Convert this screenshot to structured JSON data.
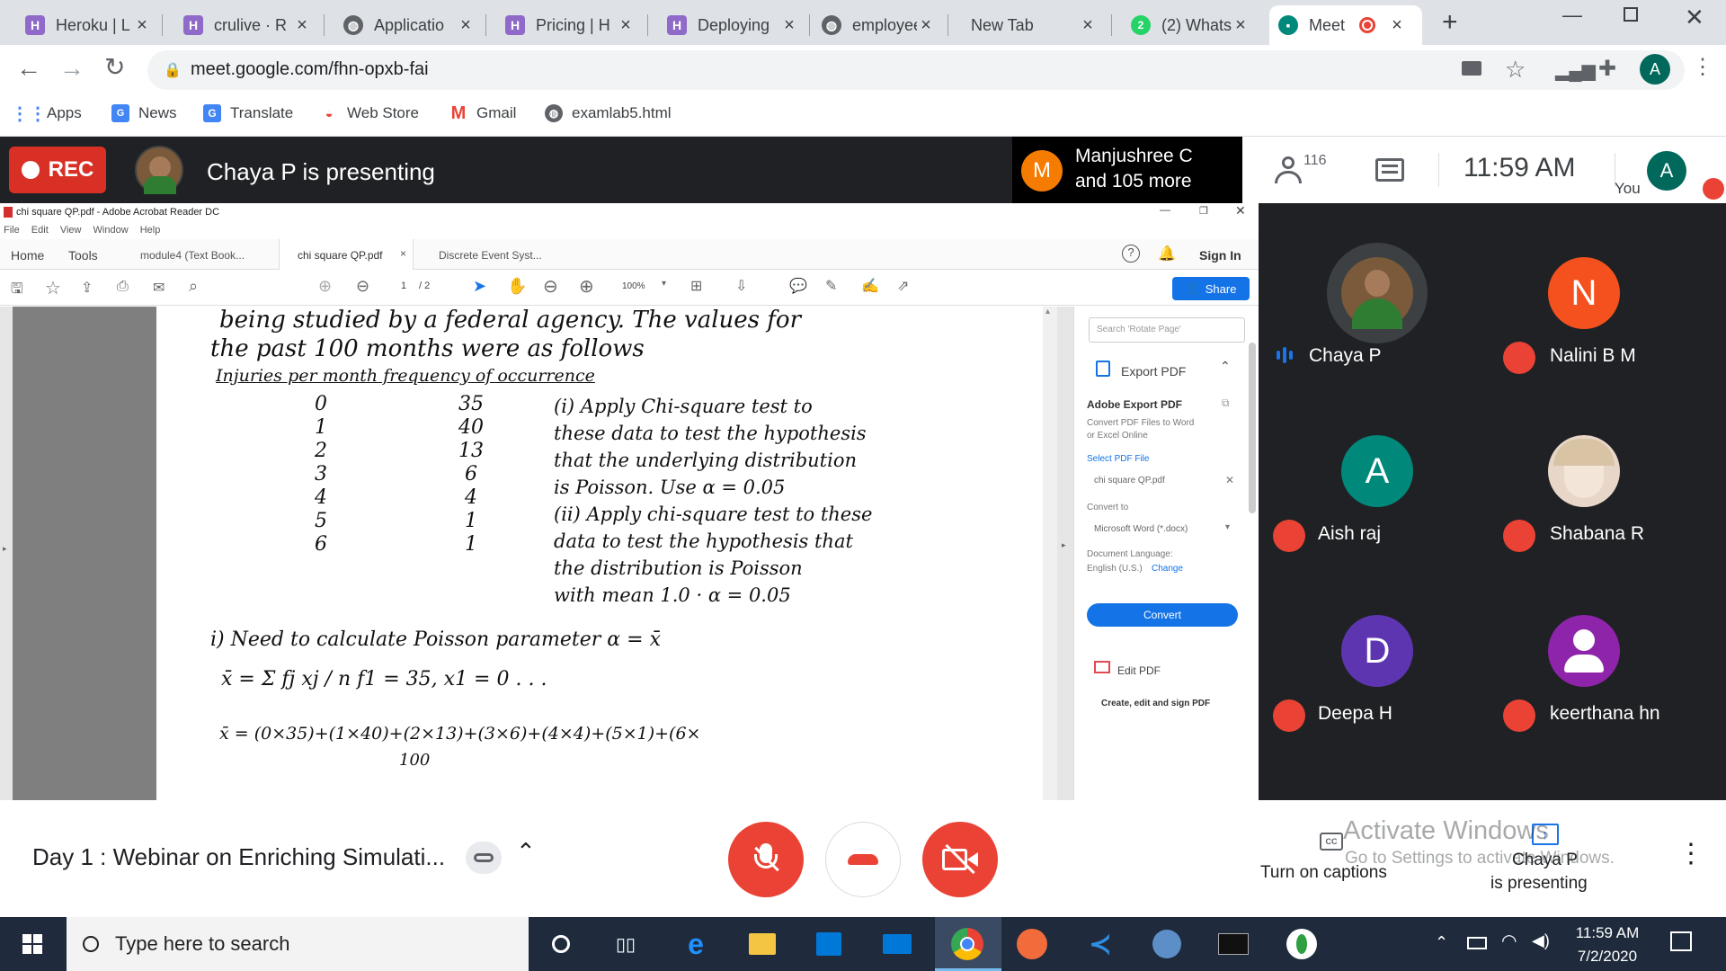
{
  "tabs": [
    {
      "label": "Heroku | L",
      "icon": "heroku-icon"
    },
    {
      "label": "crulive · R",
      "icon": "heroku-icon"
    },
    {
      "label": "Applicatio",
      "icon": "globe-icon"
    },
    {
      "label": "Pricing | H",
      "icon": "heroku-icon"
    },
    {
      "label": "Deploying",
      "icon": "heroku-icon"
    },
    {
      "label": "employee",
      "icon": "globe-icon"
    },
    {
      "label": "New Tab",
      "icon": ""
    },
    {
      "label": "(2) Whats",
      "icon": "whatsapp-icon",
      "badge": "2"
    },
    {
      "label": "Meet",
      "icon": "meet-icon",
      "active": true
    }
  ],
  "address": {
    "url": "meet.google.com/fhn-opxb-fai"
  },
  "bookmarks": [
    {
      "label": "Apps",
      "icon": "apps-grid-icon"
    },
    {
      "label": "News",
      "icon": "news-icon"
    },
    {
      "label": "Translate",
      "icon": "translate-icon"
    },
    {
      "label": "Web Store",
      "icon": "webstore-icon"
    },
    {
      "label": "Gmail",
      "icon": "gmail-icon"
    },
    {
      "label": "examlab5.html",
      "icon": "globe-icon"
    }
  ],
  "meet": {
    "rec_label": "REC",
    "presenting_label": "Chaya P is presenting",
    "joined_avatar_letter": "M",
    "joined_line1": "Manjushree C",
    "joined_line2": "and 105 more",
    "participants_count": "116",
    "time": "11:59 AM",
    "self_label": "You",
    "self_letter": "A",
    "participants": [
      {
        "name": "Chaya P",
        "letter": "",
        "color": "#5f6368",
        "muted": false
      },
      {
        "name": "Nalini B M",
        "letter": "N",
        "color": "#f4511e",
        "muted": true
      },
      {
        "name": "Aish raj",
        "letter": "A",
        "color": "#00897b",
        "muted": true
      },
      {
        "name": "Shabana R",
        "letter": "",
        "color": "#e8d7c8",
        "muted": true
      },
      {
        "name": "Deepa H",
        "letter": "D",
        "color": "#5e35b1",
        "muted": true
      },
      {
        "name": "keerthana hn",
        "letter": "",
        "color": "#8e24aa",
        "muted": true
      }
    ],
    "meeting_title": "Day 1 : Webinar on Enriching Simulati...",
    "captions_label": "Turn on captions",
    "presenter_line1": "Chaya P",
    "presenter_line2": "is presenting",
    "activate_title": "Activate Windows",
    "activate_sub": "Go to Settings to activate Windows."
  },
  "acrobat": {
    "window_title": "chi square QP.pdf - Adobe Acrobat Reader DC",
    "menu": [
      "File",
      "Edit",
      "View",
      "Window",
      "Help"
    ],
    "home": "Home",
    "tools": "Tools",
    "doc_tabs": [
      "module4 (Text Book...",
      "chi square QP.pdf",
      "Discrete Event Syst..."
    ],
    "sign_in": "Sign In",
    "page_current": "1",
    "page_total": "/ 2",
    "zoom": "100%",
    "share": "Share",
    "search_placeholder": "Search 'Rotate Page'",
    "export_pdf": "Export PDF",
    "adobe_export_title": "Adobe Export PDF",
    "adobe_export_desc1": "Convert PDF Files to Word",
    "adobe_export_desc2": "or Excel Online",
    "select_file": "Select PDF File",
    "file_name": "chi square QP.pdf",
    "convert_to": "Convert to",
    "convert_format": "Microsoft Word (*.docx)",
    "doc_lang": "Document Language:",
    "lang_value": "English (U.S.)",
    "lang_change": "Change",
    "convert_button": "Convert",
    "edit_pdf": "Edit PDF",
    "create_edit": "Create, edit and sign PDF"
  },
  "handwriting": {
    "line1": "being studied by a federal agency. The values for",
    "line2": "the past 100 months were as follows",
    "header": "Injuries per month   frequency of occurrence",
    "rows": [
      {
        "x": "0",
        "f": "35"
      },
      {
        "x": "1",
        "f": "40"
      },
      {
        "x": "2",
        "f": "13"
      },
      {
        "x": "3",
        "f": "6"
      },
      {
        "x": "4",
        "f": "4"
      },
      {
        "x": "5",
        "f": "1"
      },
      {
        "x": "6",
        "f": "1"
      }
    ],
    "q1a": "(i) Apply Chi-square test to",
    "q1b": "these data to test the hypothesis",
    "q1c": "that the underlying distribution",
    "q1d": "is Poisson. Use α = 0.05",
    "q2a": "(ii) Apply chi-square test to these",
    "q2b": "data to test the hypothesis that",
    "q2c": "the distribution is Poisson",
    "q2d": "with mean 1.0 · α = 0.05",
    "sol1": "i) Need to calculate Poisson parameter α = x̄",
    "sol2": "x̄ = Σ fj xj / n     f1 = 35, x1 = 0 . . .",
    "sol3": "x̄ = (0×35)+(1×40)+(2×13)+(3×6)+(4×4)+(5×1)+(6×",
    "sol4": "100"
  },
  "taskbar": {
    "search_placeholder": "Type here to search",
    "time": "11:59 AM",
    "date": "7/2/2020"
  }
}
